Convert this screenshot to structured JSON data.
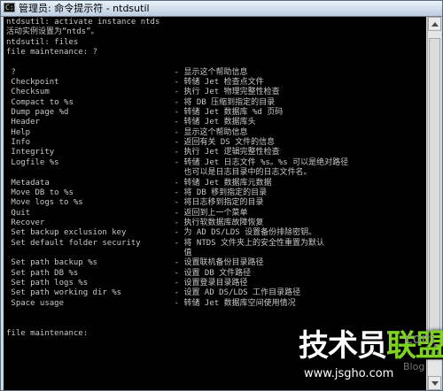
{
  "window": {
    "title": "管理员: 命令提示符 - ntdsutil",
    "icon_label": "C:\\"
  },
  "console": {
    "lines": [
      "ntdsutil: activate instance ntds",
      "活动实例设置为“ntds”。",
      "ntdsutil: files",
      "file maintenance: ?",
      "",
      " ?                                 - 显示这个帮助信息",
      " Checkpoint                        - 转储 Jet 检查点文件",
      " Checksum                          - 执行 Jet 物理完整性检查",
      " Compact to %s                     - 将 DB 压缩到指定的目录",
      " Dump page %d                      - 转储 Jet 数据库 %d 页码",
      " Header                            - 转储 Jet 数据库头",
      " Help                              - 显示这个帮助信息",
      " Info                              - 返回有关 DS 文件的信息",
      " Integrity                         - 执行 Jet 逻辑完整性检查",
      " Logfile %s                        - 转储 Jet 日志文件 %s。%s 可以是绝对路径",
      "                                     也可以是日志目录中的日志文件名。",
      " Metadata                          - 转储 Jet 数据库元数据",
      " Move DB to %s                     - 将 DB 移到指定的目录",
      " Move logs to %s                   - 将日志移到指定的目录",
      " Quit                              - 返回到上一个菜单",
      " Recover                           - 执行软数据库故障恢复",
      " Set backup exclusion key          - 为 AD DS/LDS 设置备份排除密钥。",
      " Set default folder security       - 将 NTDS 文件夹上的安全性重置为默认",
      "                                     值",
      " Set path backup %s                - 设置联机备份目录路径",
      " Set path DB %s                    - 设置 DB 文件路径",
      " Set path logs %s                  - 设置登录目录路径",
      " Set path working dir %s           - 设置 AD DS/LDS 工作目录路径",
      " Space usage                       - 转储 Jet 数据库空间使用情况",
      "",
      "",
      "file maintenance:"
    ]
  },
  "watermark": {
    "main_white": "技术员",
    "main_green": "联盟",
    "com": "com",
    "blog": "Blog",
    "url": "www.jsgho.com"
  }
}
